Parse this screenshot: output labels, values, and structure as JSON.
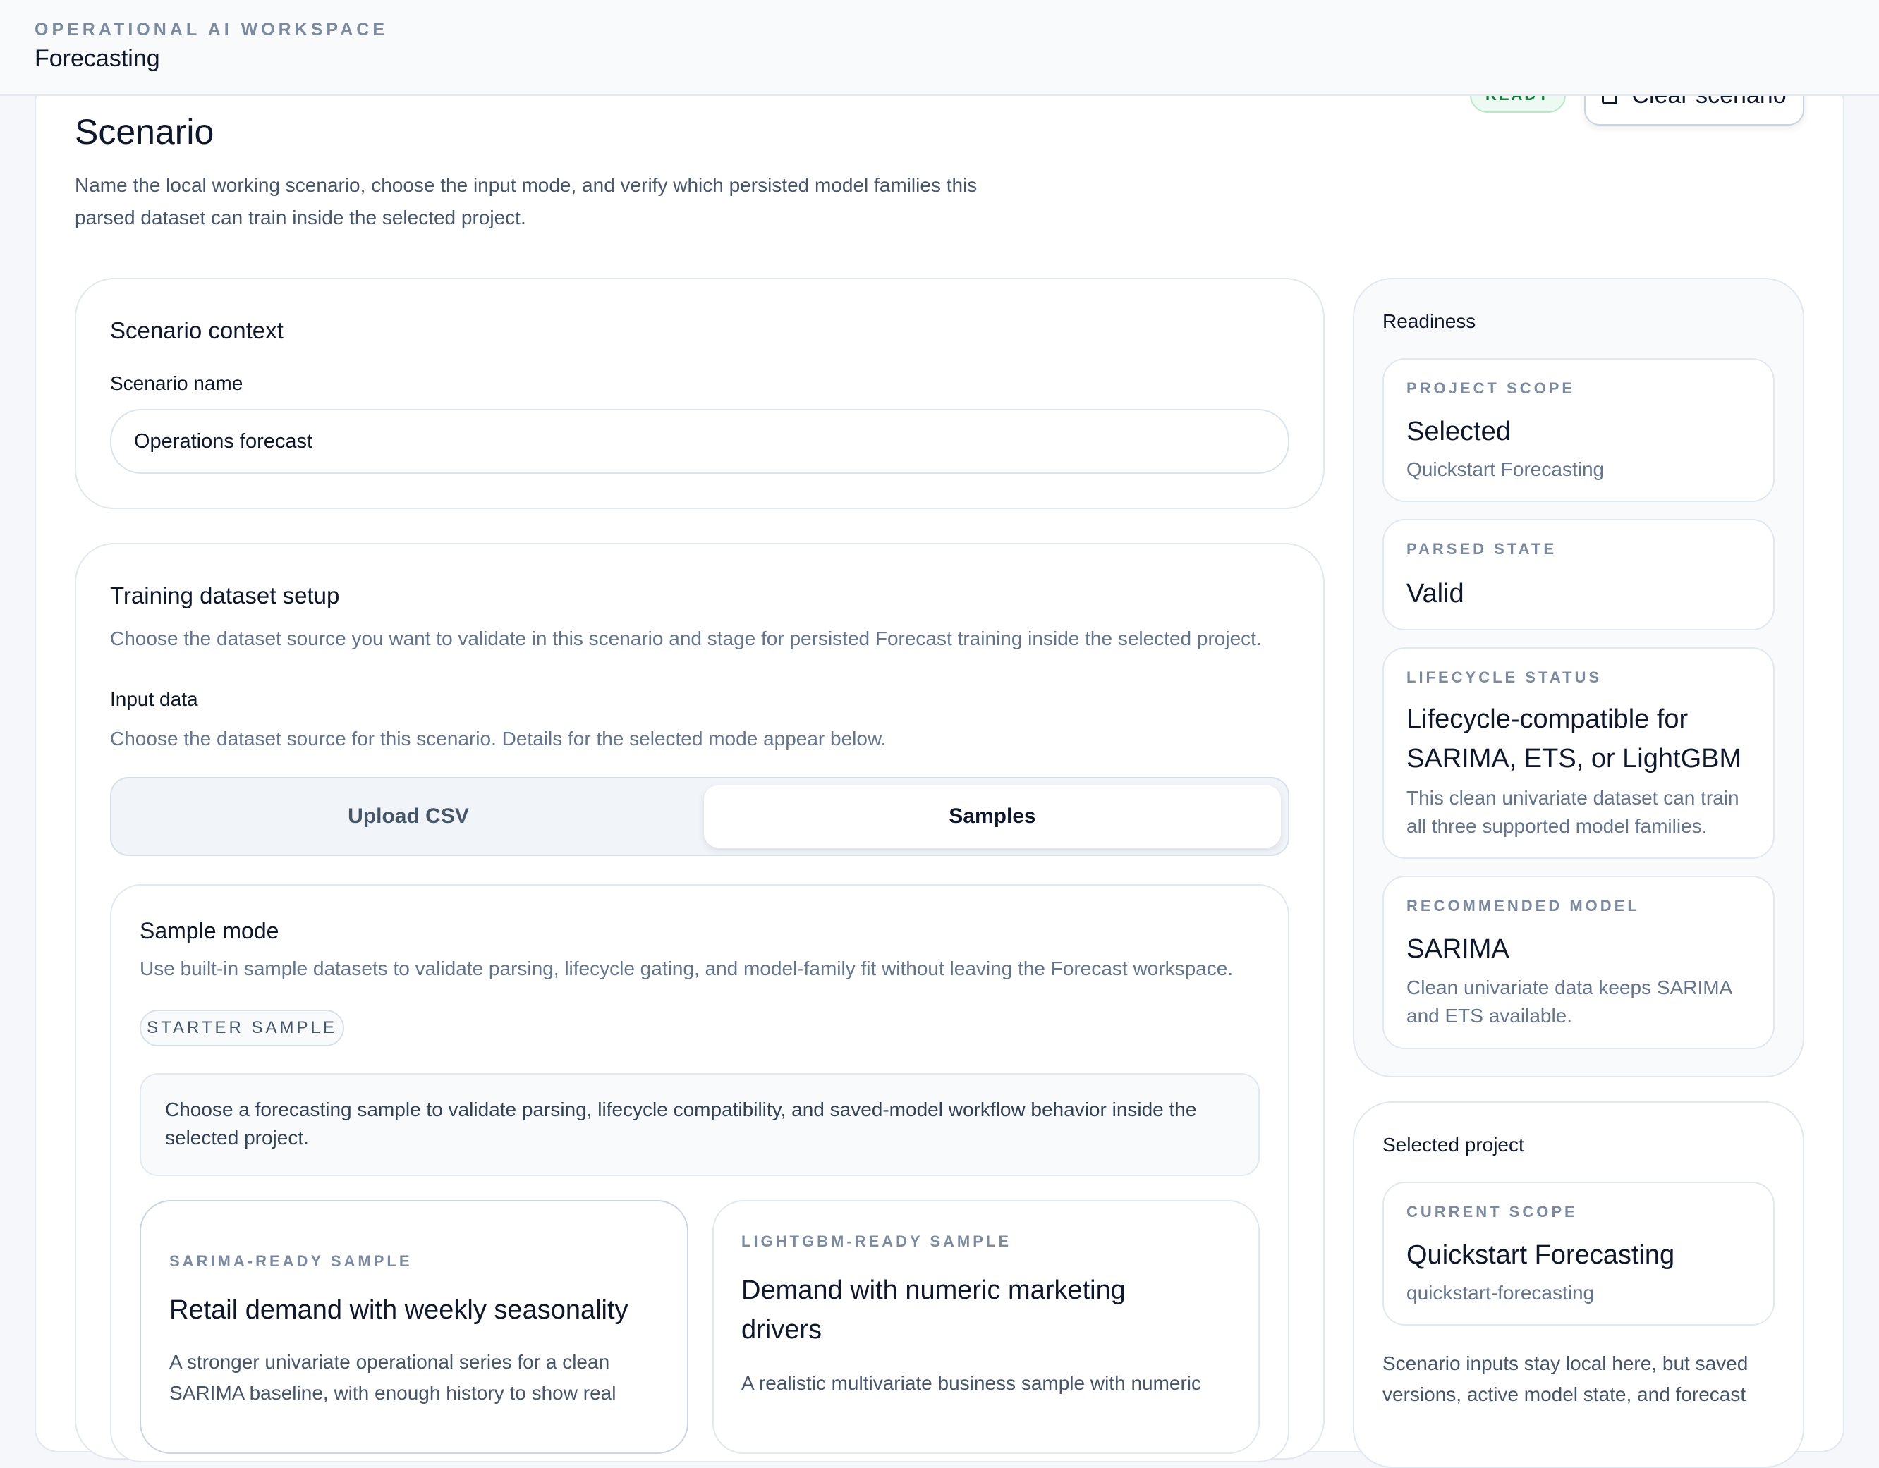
{
  "header": {
    "eyebrow": "OPERATIONAL AI WORKSPACE",
    "title": "Forecasting"
  },
  "scenario": {
    "status_badge": "READY",
    "clear_button": "Clear scenario",
    "title": "Scenario",
    "description": "Name the local working scenario, choose the input mode, and verify which persisted model families this parsed dataset can train inside the selected project."
  },
  "context": {
    "title": "Scenario context",
    "name_label": "Scenario name",
    "name_value": "Operations forecast"
  },
  "dataset": {
    "title": "Training dataset setup",
    "description": "Choose the dataset source you want to validate in this scenario and stage for persisted Forecast training inside the selected project.",
    "input_label": "Input data",
    "input_help": "Choose the dataset source for this scenario. Details for the selected mode appear below.",
    "tabs": [
      {
        "label": "Upload CSV",
        "active": false
      },
      {
        "label": "Samples",
        "active": true
      }
    ]
  },
  "sample_mode": {
    "title": "Sample mode",
    "description": "Use built-in sample datasets to validate parsing, lifecycle gating, and model-family fit without leaving the Forecast workspace.",
    "pill": "STARTER SAMPLE",
    "note": "Choose a forecasting sample to validate parsing, lifecycle compatibility, and saved-model workflow behavior inside the selected project.",
    "samples": [
      {
        "eyebrow": "SARIMA-READY SAMPLE",
        "title": "Retail demand with weekly seasonality",
        "body": "A stronger univariate operational series for a clean SARIMA baseline, with enough history to show real"
      },
      {
        "eyebrow": "LIGHTGBM-READY SAMPLE",
        "title": "Demand with numeric marketing drivers",
        "body": "A realistic multivariate business sample with numeric"
      }
    ]
  },
  "readiness": {
    "title": "Readiness",
    "items": [
      {
        "eyebrow": "PROJECT SCOPE",
        "value": "Selected",
        "detail": "Quickstart Forecasting"
      },
      {
        "eyebrow": "PARSED STATE",
        "value": "Valid",
        "detail": ""
      },
      {
        "eyebrow": "LIFECYCLE STATUS",
        "value": "Lifecycle-compatible for SARIMA, ETS, or LightGBM",
        "detail": "This clean univariate dataset can train all three supported model families."
      },
      {
        "eyebrow": "RECOMMENDED MODEL",
        "value": "SARIMA",
        "detail": "Clean univariate data keeps SARIMA and ETS available."
      }
    ]
  },
  "project": {
    "title": "Selected project",
    "eyebrow": "CURRENT SCOPE",
    "name": "Quickstart Forecasting",
    "slug": "quickstart-forecasting",
    "note": "Scenario inputs stay local here, but saved versions, active model state, and forecast"
  },
  "colors": {
    "accent_ready": "#15803d",
    "text_primary": "#0f172a",
    "text_muted": "#64748b"
  },
  "icons": {
    "clear": "trash-icon"
  }
}
